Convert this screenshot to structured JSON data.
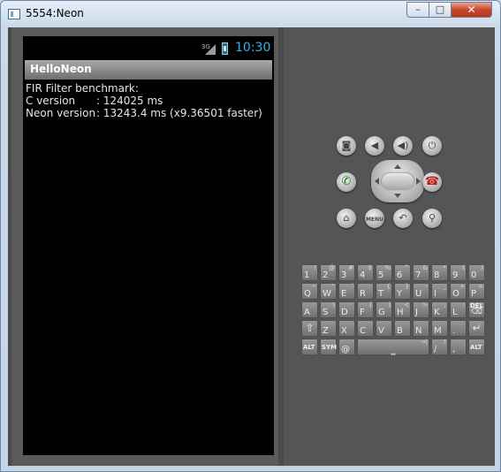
{
  "window": {
    "title": "5554:Neon",
    "controls": {
      "minimize": "–",
      "maximize": "□",
      "close": "✕"
    }
  },
  "status_bar": {
    "network": "3G",
    "time": "10:30"
  },
  "app": {
    "title": "HelloNeon"
  },
  "content": {
    "line1": "FIR Filter benchmark:",
    "rows": [
      {
        "label": "C version",
        "value": ": 124025 ms"
      },
      {
        "label": "Neon version",
        "value": ": 13243.4 ms (x9.36501 faster)"
      }
    ]
  },
  "controls": {
    "top_row": [
      "camera-icon",
      "volume-down-icon",
      "volume-up-icon",
      "power-icon"
    ],
    "call": "call-icon",
    "end_call": "end-call-icon",
    "bottom_row": {
      "home": "home-icon",
      "menu": "MENU",
      "back": "back-icon",
      "search": "search-icon"
    }
  },
  "keyboard": {
    "row1": [
      [
        "1",
        "!"
      ],
      [
        "2",
        "@"
      ],
      [
        "3",
        "#"
      ],
      [
        "4",
        "$"
      ],
      [
        "5",
        "%"
      ],
      [
        "6",
        "^"
      ],
      [
        "7",
        "&"
      ],
      [
        "8",
        "*"
      ],
      [
        "9",
        "("
      ],
      [
        "0",
        ")"
      ]
    ],
    "row2": [
      [
        "Q",
        "~"
      ],
      [
        "W",
        "\""
      ],
      [
        "E",
        "´"
      ],
      [
        "R",
        ""
      ],
      [
        "T",
        "{"
      ],
      [
        "Y",
        "}"
      ],
      [
        "U",
        "-"
      ],
      [
        "I",
        "_"
      ],
      [
        "O",
        "+"
      ],
      [
        "P",
        "="
      ]
    ],
    "row3": [
      [
        "A",
        ""
      ],
      [
        "S",
        "\\"
      ],
      [
        "D",
        ""
      ],
      [
        "F",
        "["
      ],
      [
        "G",
        "]"
      ],
      [
        "H",
        "<"
      ],
      [
        "J",
        ">"
      ],
      [
        "K",
        ";"
      ],
      [
        "L",
        ":"
      ]
    ],
    "del": "DEL",
    "row4": [
      "Z",
      "X",
      "C",
      "V",
      "B",
      "N",
      "M",
      "."
    ],
    "row5": {
      "alt_left": "ALT",
      "sym": "SYM",
      "at": "@",
      "slash": "/",
      "question": "?",
      "comma": ",",
      "alt_right": "ALT"
    }
  },
  "colors": {
    "clock": "#33b5e5",
    "call": "#1a7a1a",
    "end_call": "#c21818"
  }
}
